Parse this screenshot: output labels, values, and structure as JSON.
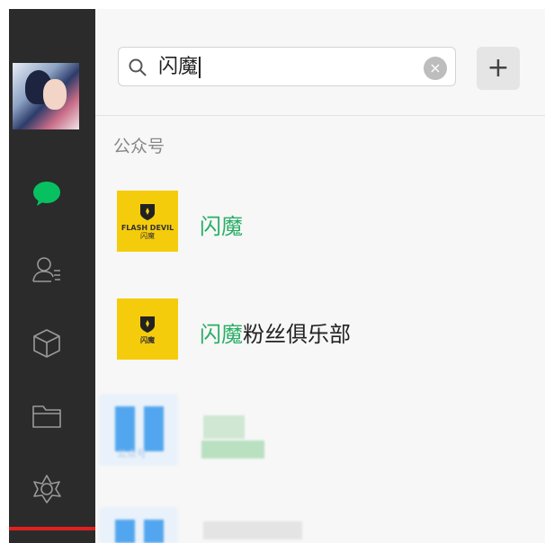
{
  "sidebar": {
    "avatar_name": "avatar",
    "icons": [
      "chat-bubble-icon",
      "contacts-icon",
      "cube-icon",
      "folder-icon",
      "moments-icon"
    ],
    "chat_color": "#07c160"
  },
  "search": {
    "query": "闪魔",
    "clear_symbol": "×",
    "add_symbol": "+"
  },
  "section_label": "公众号",
  "results": [
    {
      "highlight": "闪魔",
      "rest": "",
      "logo_text": "FLASH DEVIL",
      "logo_sub": "闪魔"
    },
    {
      "highlight": "闪魔",
      "rest": "粉丝俱乐部",
      "logo_text": "闪魔",
      "logo_sub": ""
    }
  ],
  "blurred": {
    "caption": "公众号"
  },
  "colors": {
    "sidebar_bg": "#2b2b2b",
    "highlight": "#2aae67",
    "logo_bg": "#f5cc0c",
    "accent_red": "#e02020"
  }
}
